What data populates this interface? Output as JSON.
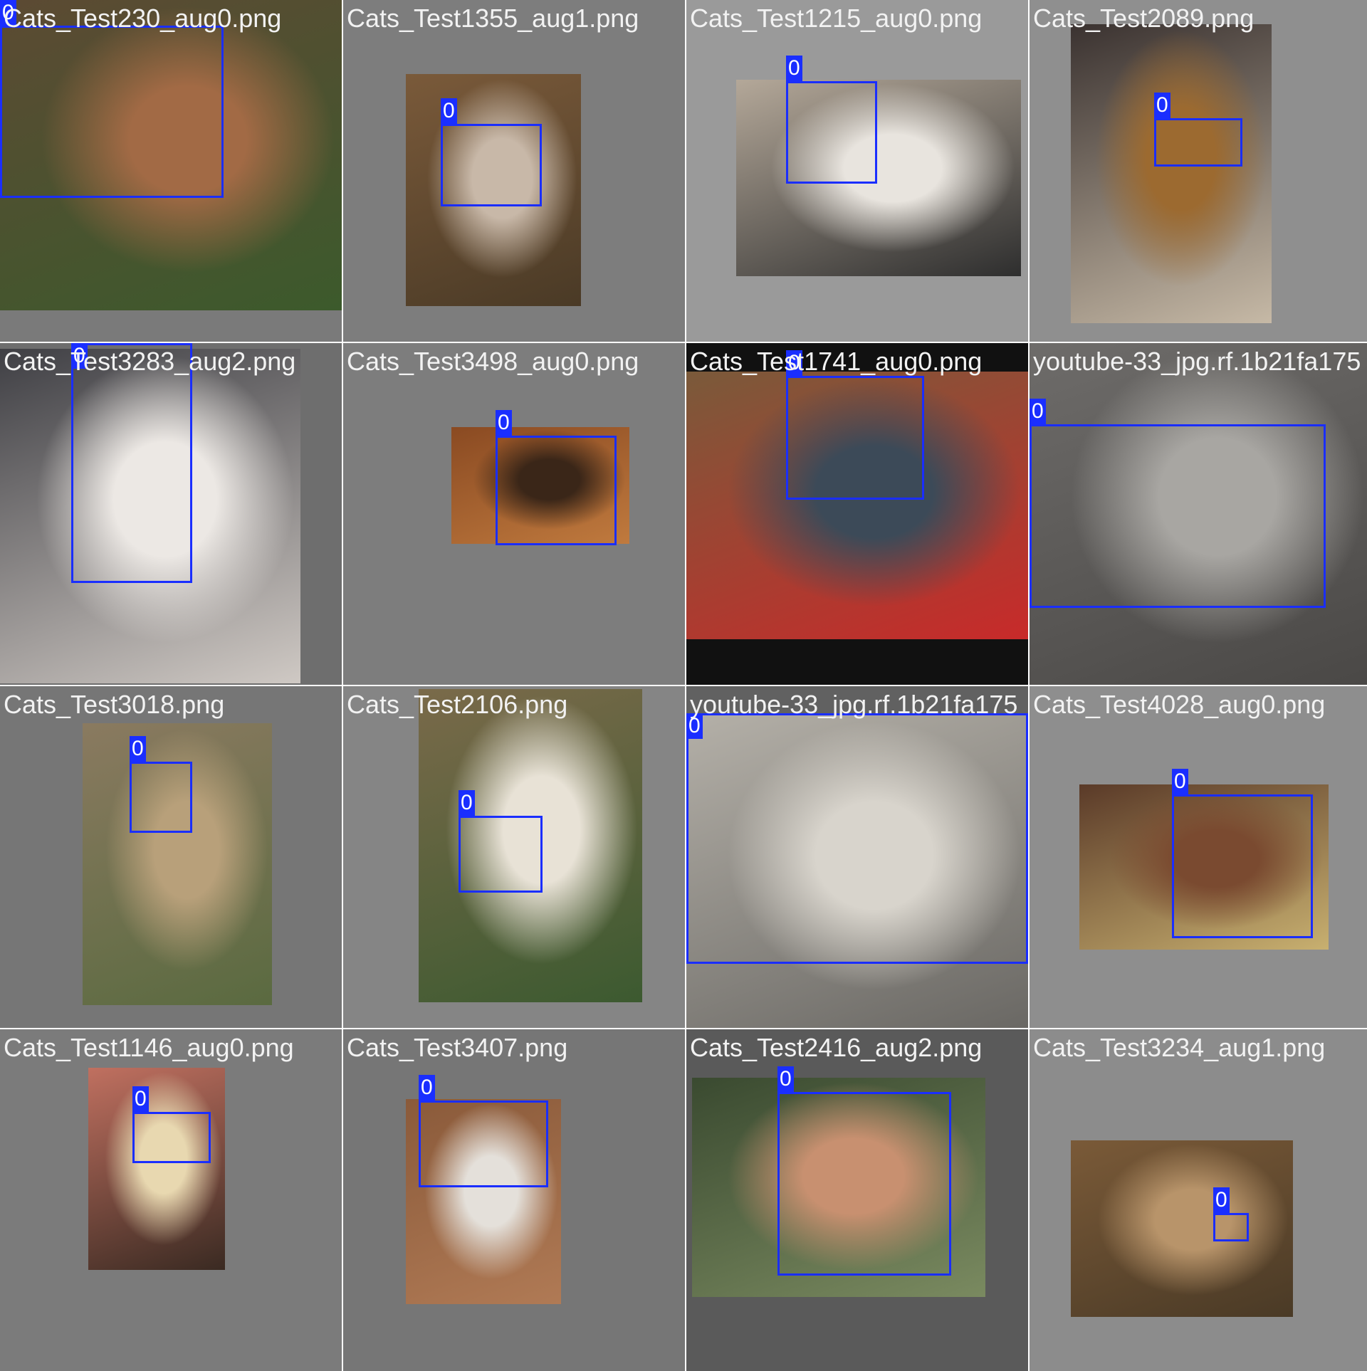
{
  "grid": {
    "background_color": "#ffffff",
    "box_color": "#1a2eff",
    "cells": [
      {
        "title": "Cats_Test230_aug0.png",
        "bg": "#7a7a7a",
        "photo_colors": [
          "#5c4a33",
          "#a26a45",
          "#3c5a2c"
        ],
        "boxes": [
          {
            "label": "0"
          }
        ]
      },
      {
        "title": "Cats_Test1355_aug1.png",
        "bg": "#7d7d7d",
        "photo_colors": [
          "#7a5a3a",
          "#c8b8a8",
          "#4a3a26"
        ],
        "boxes": [
          {
            "label": "0"
          }
        ]
      },
      {
        "title": "Cats_Test1215_aug0.png",
        "bg": "#9a9a9a",
        "photo_colors": [
          "#b4a899",
          "#e8e4de",
          "#2e2e2e"
        ],
        "boxes": [
          {
            "label": "0"
          }
        ]
      },
      {
        "title": "Cats_Test2089.png",
        "bg": "#8f8f8f",
        "photo_colors": [
          "#3a3230",
          "#9c6a30",
          "#c6b9a6"
        ],
        "boxes": [
          {
            "label": "0"
          }
        ]
      },
      {
        "title": "Cats_Test3283_aug2.png",
        "bg": "#6e6e6e",
        "photo_colors": [
          "#3f3f44",
          "#ece8e4",
          "#cfc9c4"
        ],
        "boxes": [
          {
            "label": "0"
          }
        ]
      },
      {
        "title": "Cats_Test3498_aug0.png",
        "bg": "#7d7d7d",
        "photo_colors": [
          "#8a4a22",
          "#3a2618",
          "#c07a3e"
        ],
        "boxes": [
          {
            "label": "0"
          }
        ]
      },
      {
        "title": "Cats_Test1741_aug0.png",
        "bg": "#111111",
        "photo_colors": [
          "#7a5a3a",
          "#3c4a58",
          "#c82a2a"
        ],
        "boxes": [
          {
            "label": "0"
          }
        ]
      },
      {
        "title": "youtube-33_jpg.rf.1b21fa175",
        "bg": "#8a8a8a",
        "photo_colors": [
          "#6e6c6a",
          "#a8a6a2",
          "#4a4846"
        ],
        "boxes": [
          {
            "label": "0"
          }
        ]
      },
      {
        "title": "Cats_Test3018.png",
        "bg": "#767676",
        "photo_colors": [
          "#8a7a60",
          "#b8a07a",
          "#5a6a40"
        ],
        "boxes": [
          {
            "label": "0"
          }
        ]
      },
      {
        "title": "Cats_Test2106.png",
        "bg": "#858585",
        "photo_colors": [
          "#7a6a4a",
          "#e8e2d6",
          "#3c5a30"
        ],
        "boxes": [
          {
            "label": "0"
          }
        ]
      },
      {
        "title": "youtube-33_jpg.rf.1b21fa175",
        "bg": "#616161",
        "photo_colors": [
          "#b4b0a8",
          "#d8d4cc",
          "#6a6864"
        ],
        "boxes": [
          {
            "label": "0"
          }
        ]
      },
      {
        "title": "Cats_Test4028_aug0.png",
        "bg": "#8e8e8e",
        "photo_colors": [
          "#5a3a28",
          "#7a4a30",
          "#c8b070"
        ],
        "boxes": [
          {
            "label": "0"
          }
        ]
      },
      {
        "title": "Cats_Test1146_aug0.png",
        "bg": "#7b7b7b",
        "photo_colors": [
          "#c07060",
          "#e8d8b0",
          "#3a2a22"
        ],
        "boxes": [
          {
            "label": "0"
          }
        ]
      },
      {
        "title": "Cats_Test3407.png",
        "bg": "#767676",
        "photo_colors": [
          "#8a5a3a",
          "#e4e0da",
          "#b07a55"
        ],
        "boxes": [
          {
            "label": "0"
          }
        ]
      },
      {
        "title": "Cats_Test2416_aug2.png",
        "bg": "#5a5a5a",
        "photo_colors": [
          "#3a4a30",
          "#c89070",
          "#7a8a60"
        ],
        "boxes": [
          {
            "label": "0"
          }
        ]
      },
      {
        "title": "Cats_Test3234_aug1.png",
        "bg": "#8c8c8c",
        "photo_colors": [
          "#7a5a38",
          "#b8946a",
          "#4a3a26"
        ],
        "boxes": [
          {
            "label": "0"
          }
        ]
      }
    ]
  }
}
